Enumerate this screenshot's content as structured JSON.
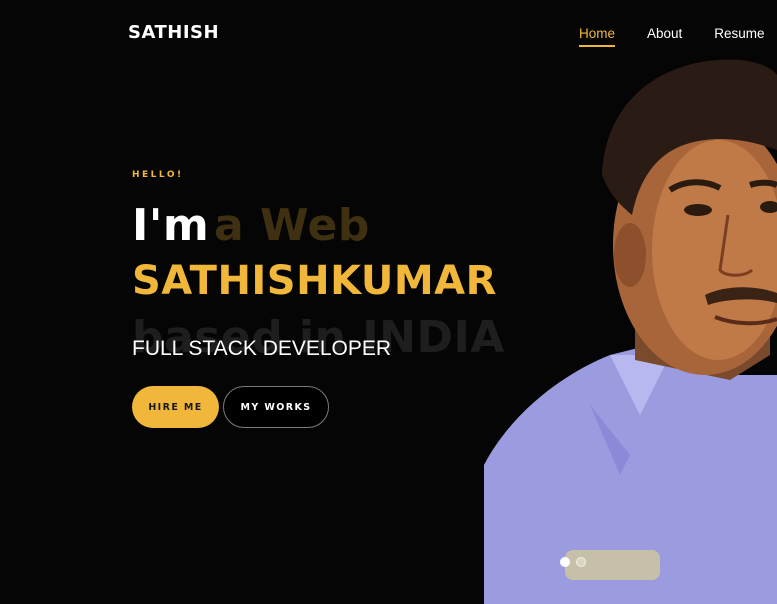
{
  "header": {
    "brand": "SATHISH",
    "nav": [
      {
        "label": "Home",
        "active": true
      },
      {
        "label": "About",
        "active": false
      },
      {
        "label": "Resume",
        "active": false
      }
    ]
  },
  "hero": {
    "eyebrow": "HELLO!",
    "im": "I'm",
    "ghost_line_1": "a Web",
    "ghost_line_2": "based in INDIA",
    "name": "SATHISHKUMAR",
    "role": "FULL STACK DEVELOPER",
    "buttons": {
      "hire": "HIRE ME",
      "works": "MY WORKS"
    }
  },
  "colors": {
    "accent": "#f1b73a",
    "background": "#000000"
  },
  "slider": {
    "count": 2,
    "active_index": 0
  }
}
